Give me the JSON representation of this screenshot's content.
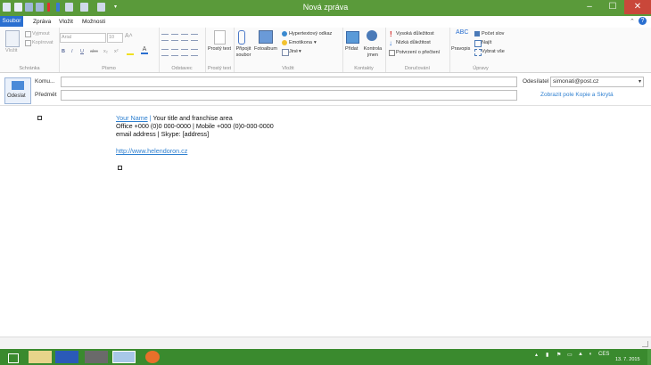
{
  "window": {
    "title": "Nová zpráva"
  },
  "tabs": [
    {
      "label": "Soubor"
    },
    {
      "label": "Zpráva"
    },
    {
      "label": "Vložit"
    },
    {
      "label": "Možnosti"
    }
  ],
  "ribbon": {
    "clipboard": {
      "paste": "Vložit",
      "cut": "Vyjmout",
      "copy": "Kopírovat",
      "label": "Schránka"
    },
    "font": {
      "name": "Arial",
      "size": "10",
      "label": "Písmo"
    },
    "paragraph": {
      "label": "Odstavec"
    },
    "plain_text": {
      "button": "Prostý text",
      "label": "Prostý text"
    },
    "insert": {
      "attach": "Připojit soubor",
      "photoalbum": "Fotoalbum",
      "hyperlink": "Hypertextový odkaz",
      "emoticon": "Emotikona",
      "other": "Jiné",
      "label": "Vložit"
    },
    "contacts": {
      "add": "Přidat",
      "check_names": "Kontrola jmen",
      "label": "Kontakty"
    },
    "delivery": {
      "high": "Vysoká důležitost",
      "low": "Nízká důležitost",
      "receipt": "Potvrzení o přečtení",
      "label": "Doručování"
    },
    "editing": {
      "spelling": "Pravopis",
      "word_count": "Počet slov",
      "find": "Najít",
      "select_all": "Vybrat vše",
      "label": "Úpravy"
    }
  },
  "compose": {
    "send": "Odeslat",
    "to_label": "Komu...",
    "subject_label": "Předmět",
    "from_label": "Odesílatel",
    "from_value": "simonati@post.cz",
    "show_cc": "Zobrazit pole Kopie a Skrytá"
  },
  "signature": {
    "your_name": "Your Name",
    "sep": "|",
    "title_line": "Your title and franchise area",
    "office_line": "Office +000 (0)0 000-0000 | Mobile +000 (0)0-000-0000",
    "email_line": "email address |  Skype: [address]",
    "url": "http://www.helendoron.cz"
  },
  "taskbar": {
    "language": "CES",
    "date": "13. 7. 2015"
  },
  "colors": {
    "titlebar": "#5a9a3a",
    "file_tab": "#2a6fd0",
    "link": "#2d7fd0",
    "taskbar": "#3a8a2e"
  }
}
